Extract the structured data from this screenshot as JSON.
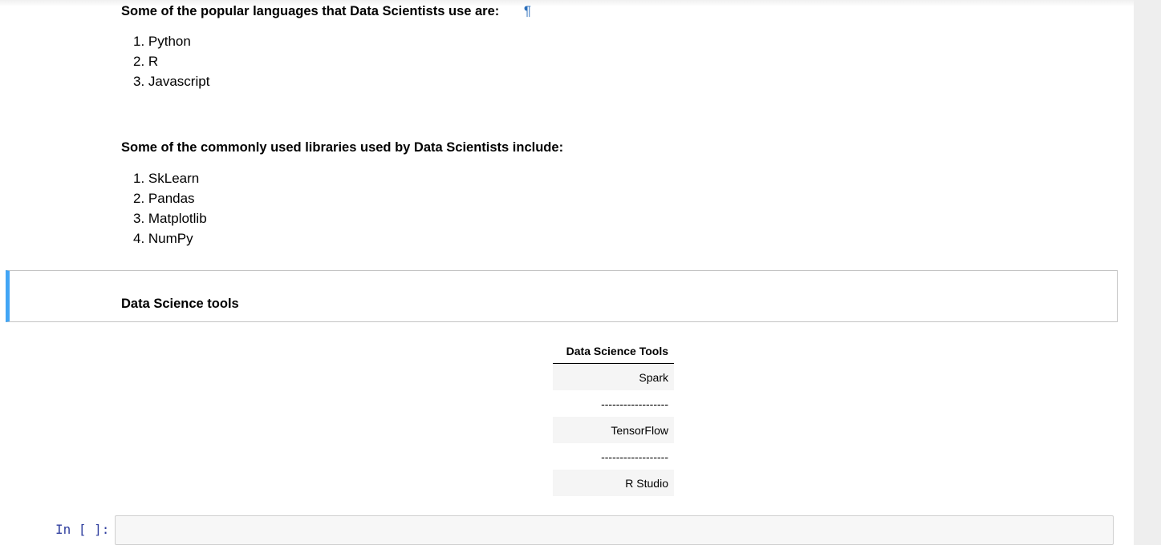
{
  "sections": {
    "languages": {
      "heading": "Some of the popular languages that Data Scientists use are:",
      "anchor": "¶",
      "items": [
        "1. Python",
        "2. R",
        "3. Javascript"
      ]
    },
    "libraries": {
      "heading": "Some of the commonly used libraries used by Data Scientists include:",
      "items": [
        "1. SkLearn",
        "2. Pandas",
        "3. Matplotlib",
        "4. NumPy"
      ]
    },
    "tools_cell": {
      "heading": "Data Science tools"
    },
    "tools_table": {
      "header": "Data Science Tools",
      "rows": [
        "Spark",
        "------------------",
        "TensorFlow",
        "------------------",
        "R Studio"
      ]
    }
  },
  "code_cell": {
    "prompt": "In [ ]:",
    "value": ""
  },
  "colors": {
    "selected_cell_accent": "#42a5f5",
    "prompt": "#303f9f",
    "anchor": "#2a6ebb"
  }
}
